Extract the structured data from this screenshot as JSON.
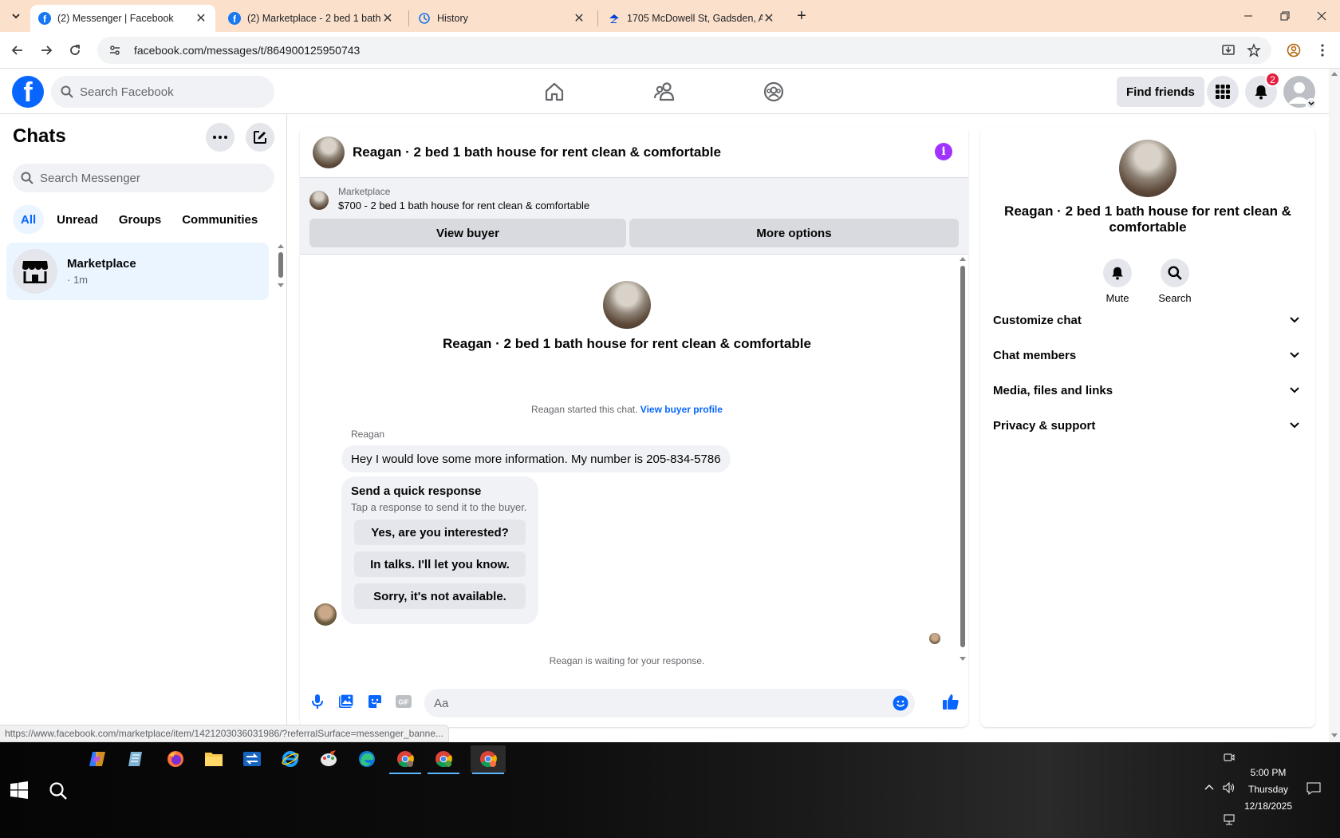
{
  "browser": {
    "tabs": [
      {
        "title": "(2) Messenger | Facebook",
        "active": true
      },
      {
        "title": "(2) Marketplace - 2 bed 1 bath h",
        "active": false
      },
      {
        "title": "History",
        "active": false
      },
      {
        "title": "1705 McDowell St, Gadsden, AL",
        "active": false
      }
    ],
    "url": "facebook.com/messages/t/864900125950743",
    "status_url": "https://www.facebook.com/marketplace/item/1421203036031986/?referralSurface=messenger_banne..."
  },
  "fb_header": {
    "search_placeholder": "Search Facebook",
    "find_friends": "Find friends",
    "notifications_count": "2"
  },
  "sidebar": {
    "title": "Chats",
    "search_placeholder": "Search Messenger",
    "filters": [
      "All",
      "Unread",
      "Groups",
      "Communities"
    ],
    "chats": [
      {
        "name": "Marketplace",
        "time": "· 1m"
      }
    ]
  },
  "conversation": {
    "title": "Reagan · 2 bed 1 bath house for rent clean & comfortable",
    "marketplace": {
      "label": "Marketplace",
      "listing": "$700 - 2 bed 1 bath house for rent clean & comfortable",
      "view_buyer": "View buyer",
      "more_options": "More options"
    },
    "intro_title": "Reagan · 2 bed 1 bath house for rent clean & comfortable",
    "started_text": "Reagan started this chat.",
    "view_profile": "View buyer profile",
    "sender": "Reagan",
    "message": "Hey I would love some more information. My number is 205-834-5786",
    "quick": {
      "title": "Send a quick response",
      "subtitle": "Tap a response to send it to the buyer.",
      "options": [
        "Yes, are you interested?",
        "In talks. I'll let you know.",
        "Sorry, it's not available."
      ]
    },
    "waiting": "Reagan is waiting for your response.",
    "composer_placeholder": "Aa"
  },
  "info_panel": {
    "name": "Reagan · 2 bed 1 bath house for rent clean & comfortable",
    "actions": [
      "Mute",
      "Search"
    ],
    "sections": [
      "Customize chat",
      "Chat members",
      "Media, files and links",
      "Privacy & support"
    ]
  },
  "taskbar": {
    "time": "5:00 PM",
    "day": "Thursday",
    "date": "12/18/2025"
  },
  "colors": {
    "facebook_blue": "#0866ff",
    "tabbar": "#fbe1cc",
    "info_purple": "#a033ff",
    "badge_red": "#e41e3f"
  }
}
